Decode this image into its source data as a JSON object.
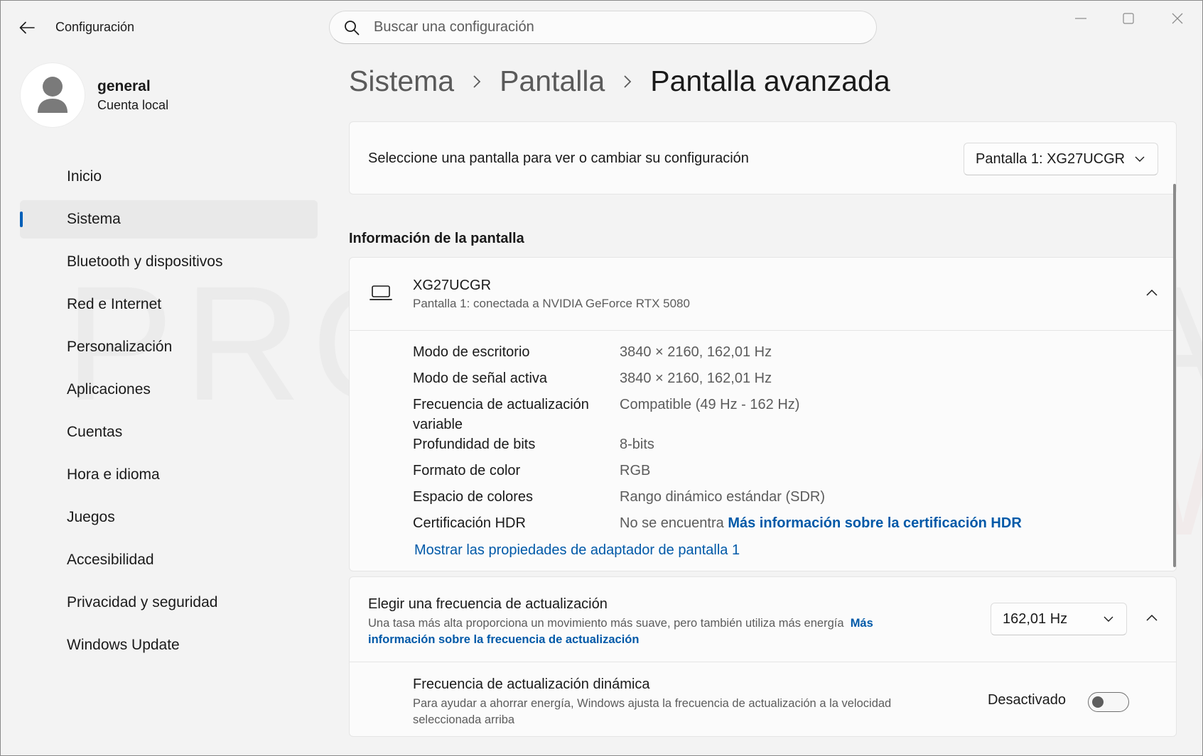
{
  "app": {
    "title": "Configuración"
  },
  "search": {
    "placeholder": "Buscar una configuración"
  },
  "profile": {
    "name": "general",
    "subtitle": "Cuenta local"
  },
  "sidebar": {
    "items": [
      {
        "label": "Inicio"
      },
      {
        "label": "Sistema",
        "selected": true
      },
      {
        "label": "Bluetooth y dispositivos"
      },
      {
        "label": "Red e Internet"
      },
      {
        "label": "Personalización"
      },
      {
        "label": "Aplicaciones"
      },
      {
        "label": "Cuentas"
      },
      {
        "label": "Hora e idioma"
      },
      {
        "label": "Juegos"
      },
      {
        "label": "Accesibilidad"
      },
      {
        "label": "Privacidad y seguridad"
      },
      {
        "label": "Windows Update"
      }
    ]
  },
  "breadcrumb": {
    "items": [
      "Sistema",
      "Pantalla",
      "Pantalla avanzada"
    ]
  },
  "display_select": {
    "label": "Seleccione una pantalla para ver o cambiar su configuración",
    "value": "Pantalla 1: XG27UCGR"
  },
  "info_section": {
    "title": "Información de la pantalla",
    "monitor_name": "XG27UCGR",
    "monitor_sub": "Pantalla 1: conectada a NVIDIA GeForce RTX 5080",
    "rows": [
      {
        "label": "Modo de escritorio",
        "value": "3840 × 2160, 162,01 Hz"
      },
      {
        "label": "Modo de señal activa",
        "value": "3840 × 2160, 162,01 Hz"
      },
      {
        "label": "Frecuencia de actualización",
        "label2": "variable",
        "value": "Compatible (49 Hz - 162 Hz)"
      },
      {
        "label": "Profundidad de bits",
        "value": "8-bits"
      },
      {
        "label": "Formato de color",
        "value": "RGB"
      },
      {
        "label": "Espacio de colores",
        "value": "Rango dinámico estándar (SDR)"
      },
      {
        "label": "Certificación HDR",
        "value": "No se encuentra",
        "link": "Más información sobre la certificación HDR"
      }
    ],
    "props_link": "Mostrar las propiedades de adaptador de pantalla 1"
  },
  "refresh_rate": {
    "title": "Elegir una frecuencia de actualización",
    "desc": "Una tasa más alta proporciona un movimiento más suave, pero también utiliza más energía",
    "link_part1": "Más",
    "link_part2": "información sobre la frecuencia de actualización",
    "value": "162,01 Hz",
    "dynamic_title": "Frecuencia de actualización dinámica",
    "dynamic_desc": "Para ayudar a ahorrar energía, Windows ajusta la frecuencia de actualización a la velocidad seleccionada arriba",
    "toggle_label": "Desactivado",
    "toggle_on": false
  },
  "watermark": {
    "line1": "PROFESIONAL",
    "line2": "review"
  },
  "colors": {
    "accent": "#005fb8",
    "link": "#0059a8",
    "background": "#f3f3f3",
    "card": "#fbfbfb"
  },
  "icons": [
    "back-arrow-icon",
    "search-icon",
    "minimize-icon",
    "maximize-icon",
    "close-icon",
    "user-icon",
    "chevron-right-icon",
    "chevron-down-icon",
    "chevron-up-icon",
    "laptop-icon"
  ]
}
